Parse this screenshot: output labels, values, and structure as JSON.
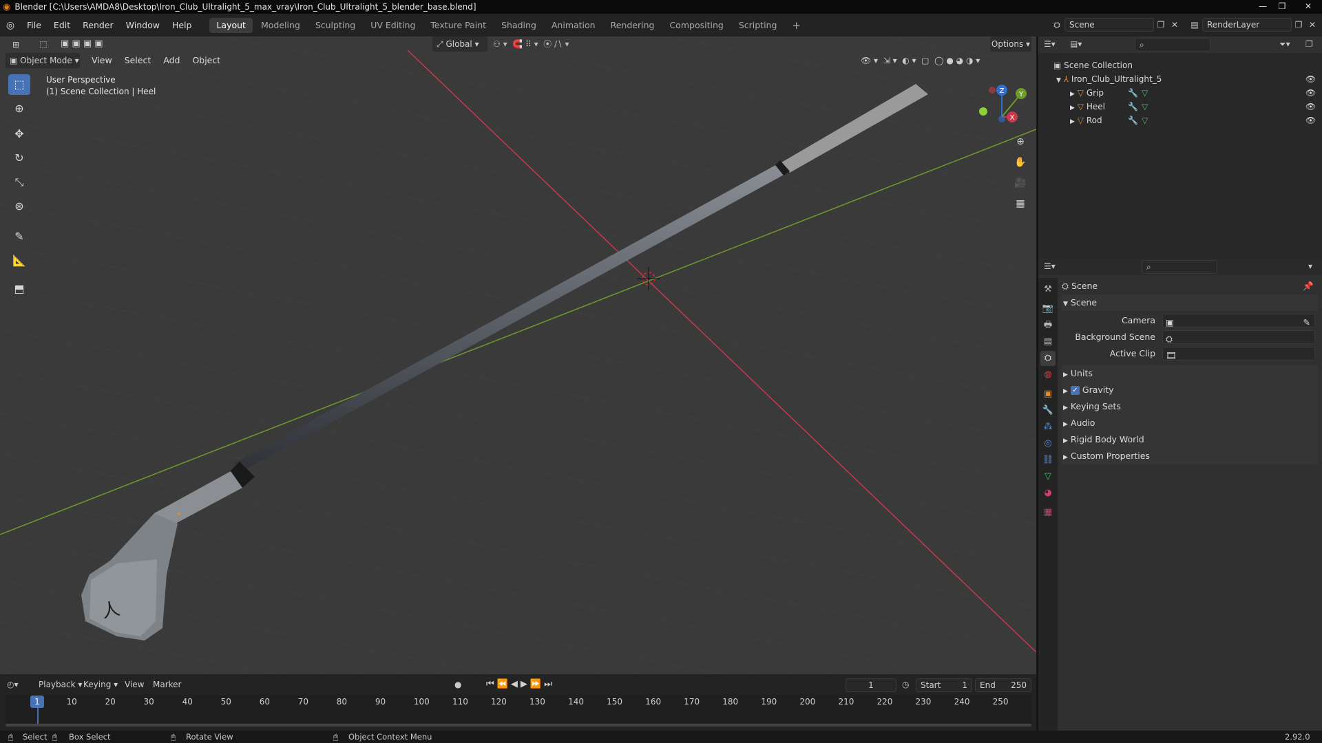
{
  "window": {
    "title": "Blender [C:\\Users\\AMDA8\\Desktop\\Iron_Club_Ultralight_5_max_vray\\Iron_Club_Ultralight_5_blender_base.blend]"
  },
  "menu": [
    "File",
    "Edit",
    "Render",
    "Window",
    "Help"
  ],
  "workspaces": [
    "Layout",
    "Modeling",
    "Sculpting",
    "UV Editing",
    "Texture Paint",
    "Shading",
    "Animation",
    "Rendering",
    "Compositing",
    "Scripting"
  ],
  "active_workspace": "Layout",
  "scene_selector": "Scene",
  "renderlayer_selector": "RenderLayer",
  "viewport": {
    "mode": "Object Mode",
    "menus": [
      "View",
      "Select",
      "Add",
      "Object"
    ],
    "orientation": "Global",
    "options_label": "Options",
    "info_line1": "User Perspective",
    "info_line2": "(1) Scene Collection | Heel",
    "gizmo_labels": {
      "x": "X",
      "y": "Y",
      "z": "Z"
    }
  },
  "outliner": {
    "root": "Scene Collection",
    "collection": "Iron_Club_Ultralight_5",
    "objects": [
      "Grip",
      "Heel",
      "Rod"
    ]
  },
  "properties": {
    "header": "Scene",
    "panel_title": "Scene",
    "fields": [
      {
        "label": "Camera",
        "value": ""
      },
      {
        "label": "Background Scene",
        "value": ""
      },
      {
        "label": "Active Clip",
        "value": ""
      }
    ],
    "subpanels": [
      "Units",
      "Gravity",
      "Keying Sets",
      "Audio",
      "Rigid Body World",
      "Custom Properties"
    ],
    "gravity_checked": true
  },
  "timeline": {
    "menus": [
      "Playback",
      "Keying",
      "View",
      "Marker"
    ],
    "current_frame": "1",
    "start_label": "Start",
    "start_value": "1",
    "end_label": "End",
    "end_value": "250",
    "ticks": [
      "1",
      "10",
      "20",
      "30",
      "40",
      "50",
      "60",
      "70",
      "80",
      "90",
      "100",
      "110",
      "120",
      "130",
      "140",
      "150",
      "160",
      "170",
      "180",
      "190",
      "200",
      "210",
      "220",
      "230",
      "240",
      "250"
    ]
  },
  "status": {
    "items": [
      "Select",
      "Box Select",
      "Rotate View",
      "Object Context Menu"
    ],
    "version": "2.92.0"
  },
  "colors": {
    "accent": "#4772b3",
    "x_axis": "#c8394a",
    "y_axis": "#6f9a2c",
    "object_orange": "#e08a2e"
  }
}
